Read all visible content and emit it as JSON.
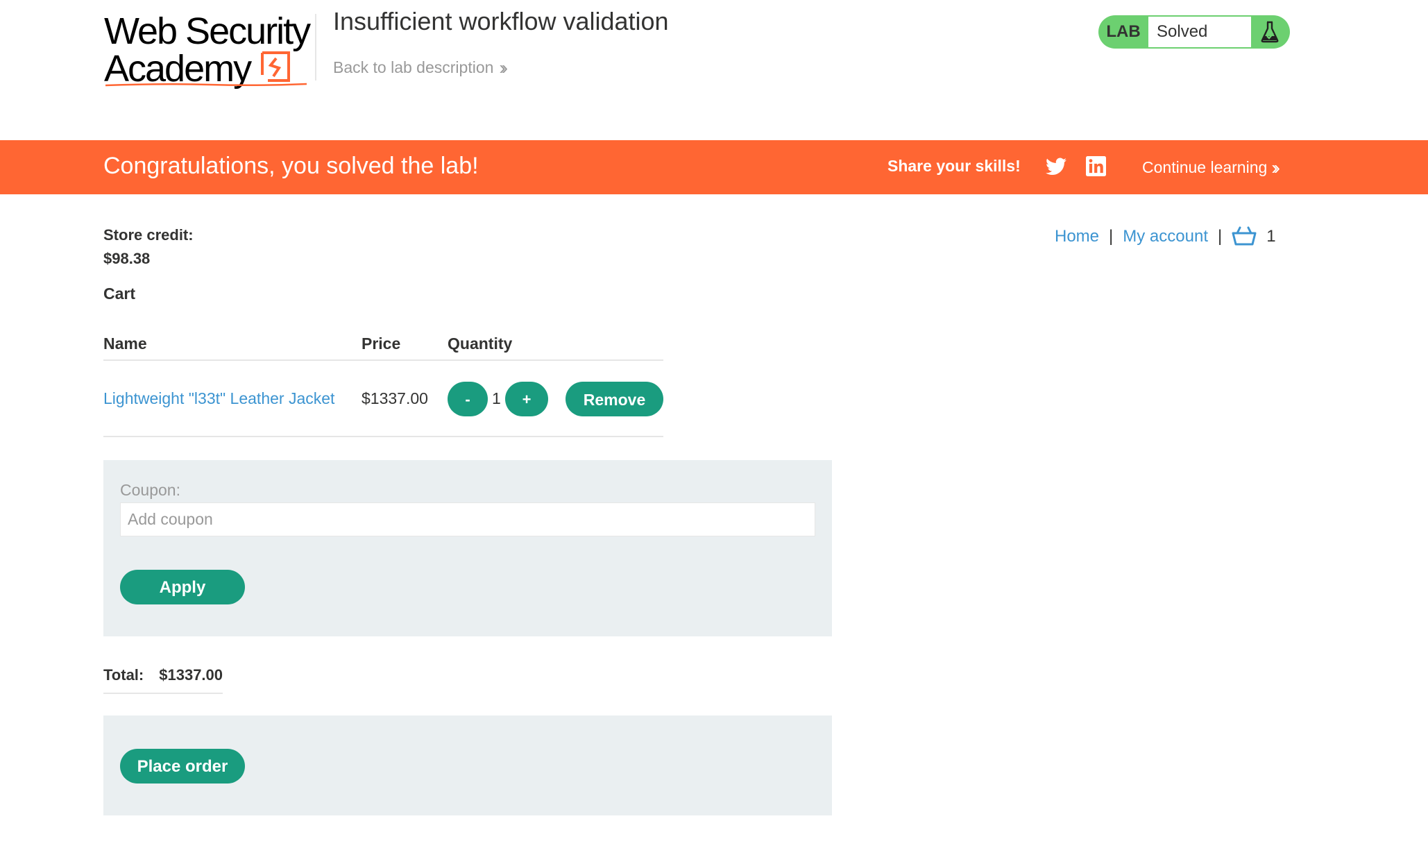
{
  "header": {
    "logo_line1": "Web Security",
    "logo_line2": "Academy",
    "lab_title": "Insufficient workflow validation",
    "back_link": "Back to lab description",
    "lab_badge": "LAB",
    "lab_status": "Solved"
  },
  "banner": {
    "message": "Congratulations, you solved the lab!",
    "share_text": "Share your skills!",
    "continue_link": "Continue learning"
  },
  "nav": {
    "home": "Home",
    "separator": "|",
    "my_account": "My account",
    "cart_count": "1"
  },
  "store": {
    "credit_label": "Store credit:",
    "credit_value": "$98.38",
    "cart_heading": "Cart"
  },
  "cart_table": {
    "headers": [
      "Name",
      "Price",
      "Quantity"
    ],
    "rows": [
      {
        "name": "Lightweight \"l33t\" Leather Jacket",
        "price": "$1337.00",
        "minus": "-",
        "quantity": "1",
        "plus": "+",
        "remove": "Remove"
      }
    ]
  },
  "coupon": {
    "label": "Coupon:",
    "placeholder": "Add coupon",
    "apply": "Apply"
  },
  "total": {
    "label": "Total:",
    "value": "$1337.00"
  },
  "order": {
    "place_order": "Place order"
  },
  "colors": {
    "brand_orange": "#ff6633",
    "button_green": "#1a9c7f",
    "link_blue": "#3c94d1",
    "lab_green": "#6cd070",
    "panel_gray": "#eaeff1"
  },
  "icons": [
    "logo",
    "double-chevron-right-icon",
    "flask-icon",
    "twitter-icon",
    "linkedin-icon",
    "shopping-basket-icon"
  ]
}
